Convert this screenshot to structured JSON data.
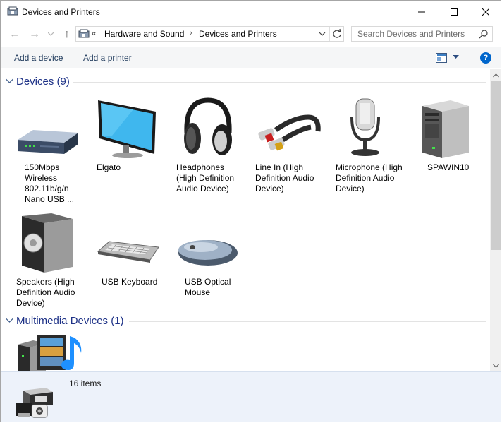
{
  "window": {
    "title": "Devices and Printers",
    "min_glyph": "—",
    "max_glyph": "☐",
    "close_glyph": "✕"
  },
  "nav": {
    "back_glyph": "←",
    "forward_glyph": "→",
    "up_glyph": "↑"
  },
  "address": {
    "overflow": "«",
    "crumbs": [
      "Hardware and Sound",
      "Devices and Printers"
    ],
    "separator": "›"
  },
  "search": {
    "placeholder": "Search Devices and Printers"
  },
  "commands": {
    "add_device": "Add a device",
    "add_printer": "Add a printer",
    "help_glyph": "?"
  },
  "groups": {
    "devices": {
      "title": "Devices (9)"
    },
    "multimedia": {
      "title": "Multimedia Devices (1)"
    }
  },
  "devices": [
    {
      "label": "150Mbps Wireless 802.11b/g/n Nano USB ...",
      "icon": "wireless-adapter-icon"
    },
    {
      "label": "Elgato",
      "icon": "monitor-icon"
    },
    {
      "label": "Headphones (High Definition Audio Device)",
      "icon": "headphones-icon"
    },
    {
      "label": "Line In (High Definition Audio Device)",
      "icon": "rca-cable-icon"
    },
    {
      "label": "Microphone (High Definition Audio Device)",
      "icon": "microphone-icon"
    },
    {
      "label": "SPAWIN10",
      "icon": "computer-tower-icon"
    },
    {
      "label": "Speakers (High Definition Audio Device)",
      "icon": "speaker-icon"
    },
    {
      "label": "USB Keyboard",
      "icon": "keyboard-icon"
    },
    {
      "label": "USB Optical Mouse",
      "icon": "mouse-icon"
    }
  ],
  "multimedia": [
    {
      "label": "",
      "icon": "media-server-icon"
    }
  ],
  "details": {
    "count": "16 items",
    "icon": "devices-and-printers-icon"
  },
  "colors": {
    "group_title": "#1e3287",
    "command_text": "#1e395b",
    "details_bg": "#edf2fa",
    "help_blue": "#0066cc"
  }
}
